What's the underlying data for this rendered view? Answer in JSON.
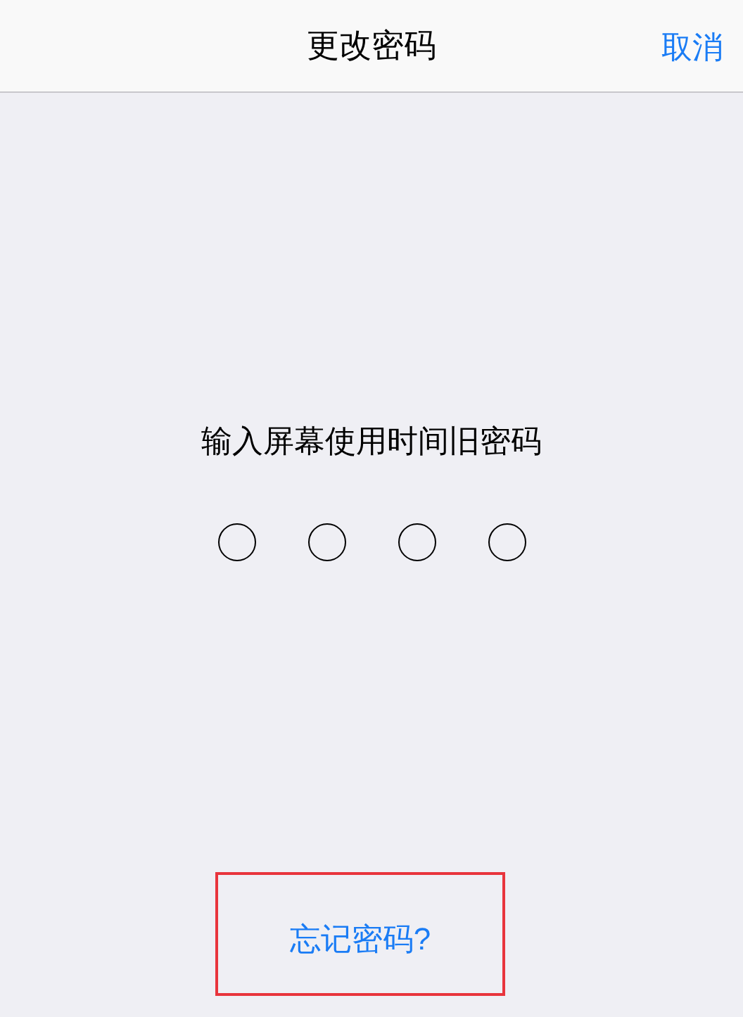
{
  "nav_bar": {
    "title": "更改密码",
    "cancel": "取消"
  },
  "prompt": "输入屏幕使用时间旧密码",
  "passcode_dots": [
    {
      "filled": false
    },
    {
      "filled": false
    },
    {
      "filled": false
    },
    {
      "filled": false
    }
  ],
  "forgot_link": {
    "label": "忘记密码?",
    "highlighted": true
  }
}
